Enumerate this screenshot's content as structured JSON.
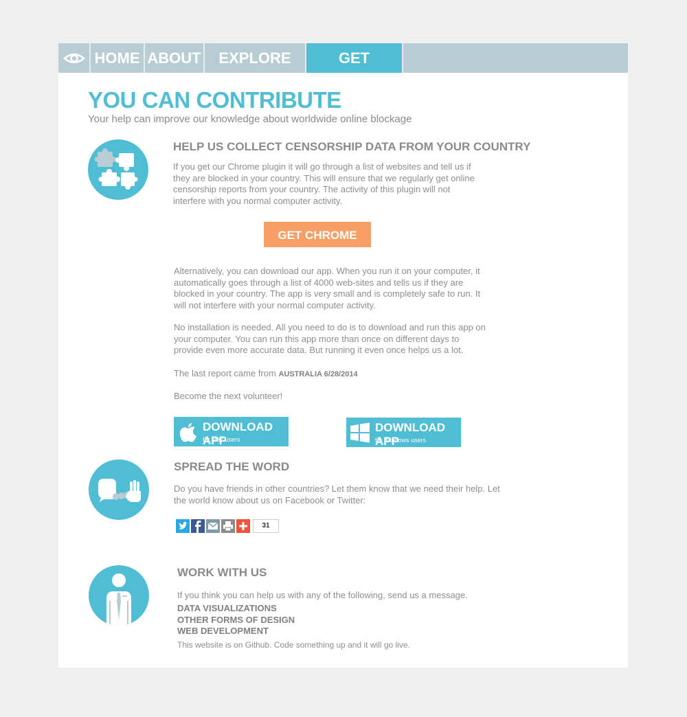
{
  "nav": {
    "home": "HOME",
    "about": "ABOUT",
    "explore": "EXPLORE DATA",
    "involved": "GET INVOLVED"
  },
  "page": {
    "title": "YOU CAN CONTRIBUTE",
    "subtitle": "Your help can improve our knowledge about worldwide online blockage"
  },
  "collect": {
    "heading": "HELP US COLLECT CENSORSHIP DATA FROM YOUR COUNTRY",
    "intro": "If you get our Chrome plugin it will go through a list of websites and tell us if they are blocked in your country. This will ensure that we regularly get online censorship reports from your country. The activity of this plugin will not interfere with you normal computer activity.",
    "plugin_button": "GET CHROME PLUGIN",
    "alt_text": "Alternatively, you can download our app. When you run it on your computer, it automatically goes through a list of 4000 web-sites and tells us if they are blocked in your country. The app is very small and is completely safe to run. It will not interfere with your normal computer activity.",
    "install_text": "No installation is needed. All you need to do is to download and run this app on your computer. You can run this app more than once on different days to provide even more accurate data. But running it even once helps us a lot.",
    "last_report_prefix": "The last report came from",
    "last_report_value": "AUSTRALIA 6/28/2014",
    "volunteer": "Become the next volunteer!",
    "mac_title": "DOWNLOAD APP",
    "mac_sub": "for Mac users",
    "win_title": "DOWNLOAD APP",
    "win_sub": "for Windows users"
  },
  "spread": {
    "heading": "SPREAD THE WORD",
    "text": "Do you have friends in other countries? Let them know that we need their help. Let the world know about us on Facebook or Twitter:",
    "share_count": "31"
  },
  "work": {
    "heading": "WORK WITH US",
    "text": "If you think you can help us with any of the following, send us a message.",
    "items": [
      "DATA VISUALIZATIONS",
      "OTHER FORMS OF DESIGN",
      "WEB DEVELOPMENT"
    ],
    "footer": "This website is on Github. Code something up and it will go live."
  },
  "colors": {
    "accent": "#4fbdd4",
    "nav_bg": "#b8cdd3",
    "orange": "#f7a065",
    "twitter": "#2aa9e0",
    "facebook": "#3b5998",
    "email": "#7f9aa8",
    "print": "#8a8a8a",
    "addthis": "#f0533a"
  }
}
